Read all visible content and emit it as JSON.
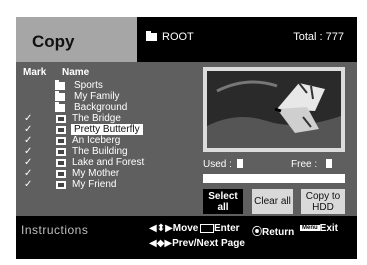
{
  "header": {
    "title": "Copy",
    "path": "ROOT",
    "total": "Total : 777"
  },
  "list": {
    "mark_header": "Mark",
    "name_header": "Name",
    "items": [
      {
        "label": "Sports",
        "type": "folder",
        "checked": ""
      },
      {
        "label": "My Family",
        "type": "folder",
        "checked": ""
      },
      {
        "label": "Background",
        "type": "folder",
        "checked": ""
      },
      {
        "label": "The Bridge",
        "type": "photo",
        "checked": "✓"
      },
      {
        "label": "Pretty Butterfly",
        "type": "photo",
        "checked": "✓",
        "selected": true
      },
      {
        "label": "An Iceberg",
        "type": "photo",
        "checked": "✓"
      },
      {
        "label": "The Building",
        "type": "photo",
        "checked": "✓"
      },
      {
        "label": "Lake and Forest",
        "type": "photo",
        "checked": "✓"
      },
      {
        "label": "My Mother",
        "type": "photo",
        "checked": "✓"
      },
      {
        "label": "My Friend",
        "type": "photo",
        "checked": "✓"
      }
    ]
  },
  "storage": {
    "used_label": "Used :",
    "free_label": "Free :"
  },
  "buttons": {
    "select_all": "Select all",
    "clear_all": "Clear all",
    "copy_to_hdd": "Copy to HDD"
  },
  "instructions": {
    "label": "Instructions",
    "move": "Move",
    "enter": "Enter",
    "return": "Return",
    "menu_tag": "Menu",
    "exit": "Exit",
    "page": "Prev/Next Page"
  },
  "colors": {
    "panel": "#5f5f5f",
    "title_left": "#a6a6a6",
    "bar": "#000000",
    "button": "#d9d9d9"
  }
}
